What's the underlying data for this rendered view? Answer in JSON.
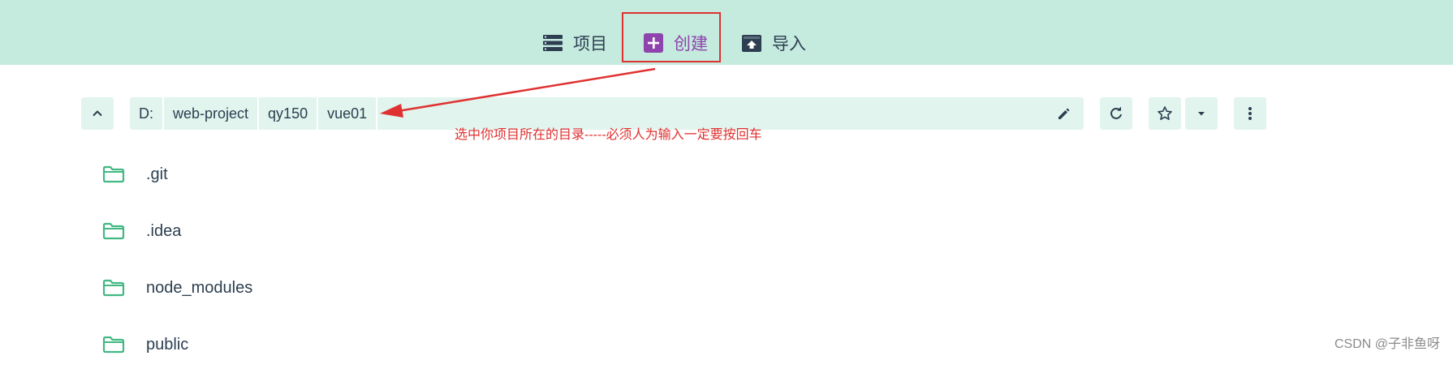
{
  "nav": {
    "items": [
      {
        "label": "项目",
        "icon": "list-icon"
      },
      {
        "label": "创建",
        "icon": "plus-square-icon"
      },
      {
        "label": "导入",
        "icon": "import-icon"
      }
    ]
  },
  "path": {
    "crumbs": [
      "D:",
      "web-project",
      "qy150",
      "vue01"
    ]
  },
  "annotation": "选中你项目所在的目录-----必须人为输入一定要按回车",
  "folders": [
    {
      "name": ".git"
    },
    {
      "name": ".idea"
    },
    {
      "name": "node_modules"
    },
    {
      "name": "public"
    }
  ],
  "watermark": "CSDN @子非鱼呀",
  "colors": {
    "topbar": "#c5eade",
    "accent": "#42b883",
    "active": "#8e44ad",
    "annotation_red": "#e03131",
    "pathbar_bg": "#e1f4ed",
    "text": "#2c3e50"
  }
}
